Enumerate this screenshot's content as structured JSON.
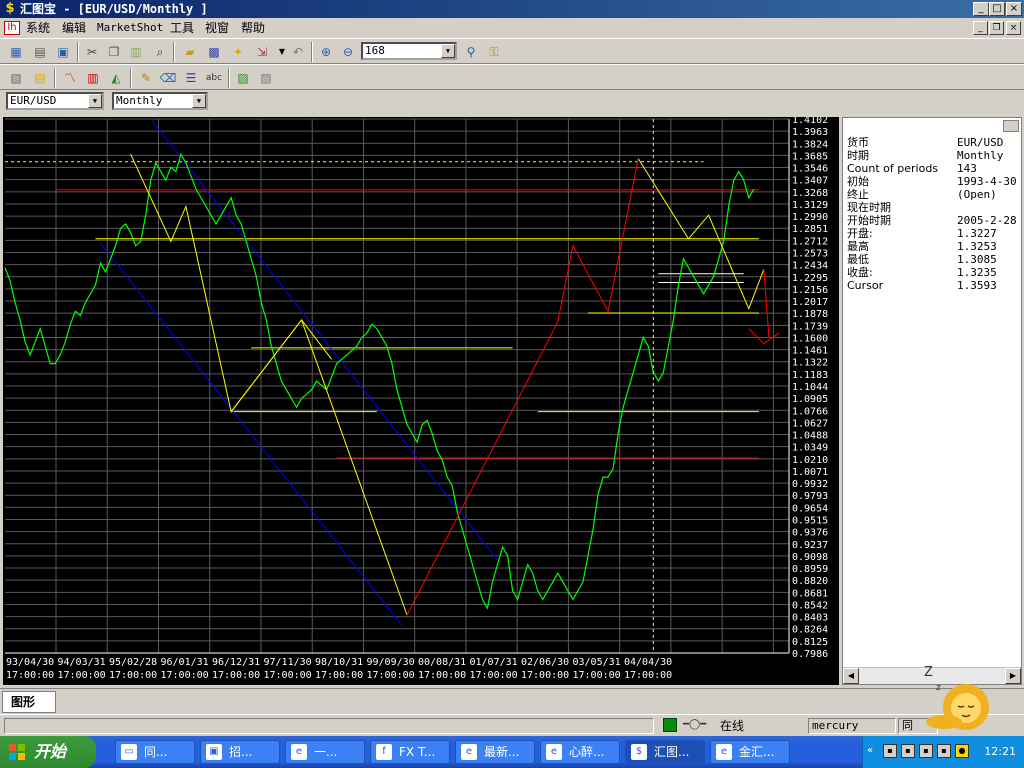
{
  "window": {
    "title": "汇图宝 - [EUR/USD/Monthly ]",
    "icon": "dollar-sign-icon",
    "controls": [
      "minimize-icon",
      "maximize-icon",
      "close-icon"
    ]
  },
  "menu": [
    "系统",
    "编辑",
    "MarketShot",
    "工具",
    "视窗",
    "帮助"
  ],
  "toolbar1": {
    "icons": [
      "open-icon",
      "print-icon",
      "print-preview-icon",
      "cut-icon",
      "copy-icon",
      "paste-icon",
      "find-icon",
      "open-folder-icon",
      "save-icon",
      "new-icon",
      "export-icon",
      "dropdown-icon",
      "zoom-in-icon",
      "zoom-out-icon"
    ],
    "zoom_value": "168"
  },
  "toolbar2": {
    "icons": [
      "data-window-icon",
      "note-icon",
      "line-chart-icon",
      "bar-chart-icon",
      "area-chart-icon",
      "pen-icon",
      "eraser-icon",
      "properties-icon",
      "text-abc-icon",
      "image-icon",
      "image-gray-icon"
    ]
  },
  "selectors": {
    "symbol": "EUR/USD",
    "period": "Monthly"
  },
  "colors": {
    "chart_bg": "#000000",
    "grid": "#5a5a5a",
    "price_line": "#00ff00",
    "trend_yellow": "#ffff00",
    "trend_red": "#ff0000",
    "channel_blue": "#0000ff",
    "axis_text": "#ffffff"
  },
  "info": [
    {
      "k": "货币",
      "v": "EUR/USD"
    },
    {
      "k": "时期",
      "v": "Monthly"
    },
    {
      "k": "Count of periods",
      "v": "143"
    },
    {
      "k": "初始",
      "v": "1993-4-30 1"
    },
    {
      "k": "终止",
      "v": "(Open)"
    },
    {
      "k": "现在时期",
      "v": ""
    },
    {
      "k": "开始时期",
      "v": "2005-2-28 1"
    },
    {
      "k": "开盘:",
      "v": "1.3227"
    },
    {
      "k": "最高",
      "v": "1.3253"
    },
    {
      "k": "最低",
      "v": "1.3085"
    },
    {
      "k": "收盘:",
      "v": "1.3235"
    },
    {
      "k": "Cursor",
      "v": "1.3593"
    }
  ],
  "tab": "图形",
  "status": {
    "online": "在线",
    "server": "mercury",
    "extra": "同"
  },
  "taskbar": {
    "start": "开始",
    "items": [
      {
        "label": "同...",
        "icon": "window-icon"
      },
      {
        "label": "招...",
        "icon": "app-icon"
      },
      {
        "label": "一...",
        "icon": "ie-icon"
      },
      {
        "label": "FX T...",
        "icon": "fx-icon"
      },
      {
        "label": "最新...",
        "icon": "ie-icon"
      },
      {
        "label": "心醉...",
        "icon": "ie-icon"
      },
      {
        "label": "汇图...",
        "icon": "dollar-sign-icon"
      },
      {
        "label": "金汇...",
        "icon": "ie-icon"
      }
    ],
    "clock": "12:21"
  },
  "chart_data": {
    "type": "line",
    "title": "",
    "ylim": [
      0.7986,
      1.4102
    ],
    "y_ticks": [
      "1.4102",
      "1.3963",
      "1.3824",
      "1.3685",
      "1.3546",
      "1.3407",
      "1.3268",
      "1.3129",
      "1.2990",
      "1.2851",
      "1.2712",
      "1.2573",
      "1.2434",
      "1.2295",
      "1.2156",
      "1.2017",
      "1.1878",
      "1.1739",
      "1.1600",
      "1.1461",
      "1.1322",
      "1.1183",
      "1.1044",
      "1.0905",
      "1.0766",
      "1.0627",
      "1.0488",
      "1.0349",
      "1.0210",
      "1.0071",
      "0.9932",
      "0.9793",
      "0.9654",
      "0.9515",
      "0.9376",
      "0.9237",
      "0.9098",
      "0.8959",
      "0.8820",
      "0.8681",
      "0.8542",
      "0.8403",
      "0.8264",
      "0.8125",
      "0.7986"
    ],
    "x_ticks": [
      {
        "date": "93/04/30",
        "time": "17:00:00"
      },
      {
        "date": "94/03/31",
        "time": "17:00:00"
      },
      {
        "date": "95/02/28",
        "time": "17:00:00"
      },
      {
        "date": "96/01/31",
        "time": "17:00:00"
      },
      {
        "date": "96/12/31",
        "time": "17:00:00"
      },
      {
        "date": "97/11/30",
        "time": "17:00:00"
      },
      {
        "date": "98/10/31",
        "time": "17:00:00"
      },
      {
        "date": "99/09/30",
        "time": "17:00:00"
      },
      {
        "date": "00/08/31",
        "time": "17:00:00"
      },
      {
        "date": "01/07/31",
        "time": "17:00:00"
      },
      {
        "date": "02/06/30",
        "time": "17:00:00"
      },
      {
        "date": "03/05/31",
        "time": "17:00:00"
      },
      {
        "date": "04/04/30",
        "time": "17:00:00"
      }
    ],
    "series": [
      {
        "values": [
          1.24,
          1.225,
          1.2,
          1.18,
          1.155,
          1.14,
          1.155,
          1.17,
          1.15,
          1.13,
          1.13,
          1.14,
          1.155,
          1.175,
          1.19,
          1.185,
          1.2,
          1.21,
          1.22,
          1.245,
          1.235,
          1.25,
          1.265,
          1.285,
          1.29,
          1.28,
          1.265,
          1.27,
          1.3,
          1.34,
          1.36,
          1.35,
          1.34,
          1.355,
          1.35,
          1.37,
          1.36,
          1.345,
          1.33,
          1.32,
          1.31,
          1.3,
          1.29,
          1.3,
          1.31,
          1.32,
          1.3,
          1.29,
          1.27,
          1.25,
          1.23,
          1.2,
          1.18,
          1.15,
          1.13,
          1.11,
          1.1,
          1.09,
          1.08,
          1.09,
          1.095,
          1.1,
          1.11,
          1.105,
          1.1,
          1.115,
          1.13,
          1.135,
          1.14,
          1.145,
          1.15,
          1.16,
          1.165,
          1.175,
          1.17,
          1.16,
          1.15,
          1.13,
          1.1,
          1.08,
          1.06,
          1.05,
          1.04,
          1.06,
          1.065,
          1.05,
          1.03,
          1.02,
          1.0,
          0.99,
          0.96,
          0.94,
          0.92,
          0.9,
          0.88,
          0.86,
          0.85,
          0.88,
          0.9,
          0.92,
          0.91,
          0.87,
          0.86,
          0.88,
          0.9,
          0.89,
          0.87,
          0.86,
          0.87,
          0.88,
          0.89,
          0.88,
          0.87,
          0.86,
          0.87,
          0.88,
          0.91,
          0.94,
          0.98,
          1.0,
          1.0,
          1.01,
          1.05,
          1.08,
          1.1,
          1.12,
          1.14,
          1.16,
          1.15,
          1.12,
          1.11,
          1.12,
          1.15,
          1.18,
          1.22,
          1.25,
          1.24,
          1.23,
          1.22,
          1.21,
          1.22,
          1.23,
          1.25,
          1.27,
          1.31,
          1.34,
          1.35,
          1.34,
          1.32,
          1.33
        ]
      }
    ],
    "horizontal_lines": [
      {
        "y": 1.3612,
        "color": "yellow",
        "style": "dashed",
        "x_start": 0,
        "x_end": 139
      },
      {
        "y": 1.329,
        "color": "red",
        "style": "solid",
        "x_start": 10,
        "x_end": 150
      },
      {
        "y": 1.273,
        "color": "yellow",
        "style": "solid",
        "x_start": 18,
        "x_end": 150
      },
      {
        "y": 1.188,
        "color": "yellow",
        "style": "solid",
        "x_start": 116,
        "x_end": 150
      },
      {
        "y": 1.148,
        "color": "yellow",
        "style": "solid",
        "x_start": 49,
        "x_end": 101
      },
      {
        "y": 1.075,
        "color": "yellow",
        "style": "solid",
        "x_start": 45,
        "x_end": 74
      },
      {
        "y": 1.075,
        "color": "yellow",
        "style": "solid",
        "x_start": 106,
        "x_end": 150
      },
      {
        "y": 1.022,
        "color": "red",
        "style": "solid",
        "x_start": 66,
        "x_end": 150
      },
      {
        "y": 1.233,
        "color": "white",
        "style": "solid",
        "x_start": 130,
        "x_end": 147
      },
      {
        "y": 1.223,
        "color": "white",
        "style": "solid",
        "x_start": 130,
        "x_end": 147
      }
    ],
    "trend_lines": [
      {
        "color": "yellow",
        "points": [
          [
            25,
            1.37
          ],
          [
            33,
            1.27
          ],
          [
            36,
            1.31
          ],
          [
            45,
            1.075
          ],
          [
            59,
            1.18
          ],
          [
            80,
            0.842
          ]
        ]
      },
      {
        "color": "yellow",
        "points": [
          [
            45,
            1.075
          ],
          [
            59,
            1.18
          ],
          [
            65,
            1.135
          ]
        ]
      },
      {
        "color": "yellow",
        "points": [
          [
            126,
            1.365
          ],
          [
            136,
            1.273
          ],
          [
            140,
            1.3
          ],
          [
            148,
            1.193
          ],
          [
            151,
            1.238
          ]
        ]
      },
      {
        "color": "red",
        "points": [
          [
            80,
            0.842
          ],
          [
            110,
            1.178
          ],
          [
            113,
            1.265
          ],
          [
            120,
            1.19
          ],
          [
            126,
            1.365
          ]
        ]
      },
      {
        "color": "red",
        "points": [
          [
            148,
            1.17
          ],
          [
            151,
            1.153
          ],
          [
            154,
            1.165
          ]
        ]
      },
      {
        "color": "red",
        "points": [
          [
            151,
            1.238
          ],
          [
            152,
            1.16
          ]
        ]
      }
    ],
    "channel_lines": [
      {
        "color": "blue",
        "points": [
          [
            29,
            1.41
          ],
          [
            98,
            0.905
          ]
        ]
      },
      {
        "color": "blue",
        "points": [
          [
            19,
            1.268
          ],
          [
            79,
            0.83
          ]
        ]
      }
    ],
    "cursor_x": 129,
    "x_count": 157,
    "grid": true
  }
}
